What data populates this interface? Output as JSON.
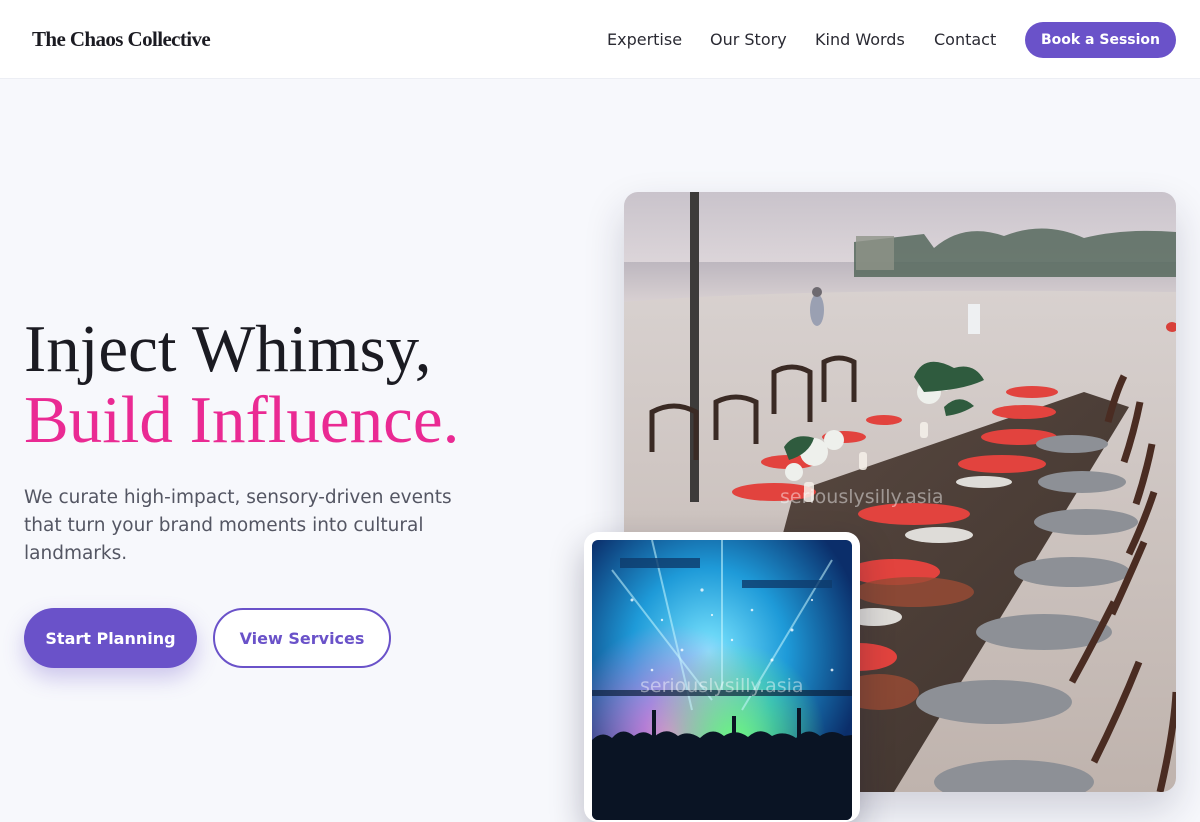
{
  "header": {
    "logo": "The Chaos Collective",
    "nav": {
      "expertise": "Expertise",
      "our_story": "Our Story",
      "kind_words": "Kind Words",
      "contact": "Contact"
    },
    "cta": "Book a Session"
  },
  "hero": {
    "headline_line1": "Inject Whimsy,",
    "headline_line2": "Build Influence.",
    "subtext": "We curate high-impact, sensory-driven events that turn your brand moments into cultural landmarks.",
    "primary_button": "Start Planning",
    "secondary_button": "View Services"
  },
  "images": {
    "main_watermark": "seriouslysilly.asia",
    "inset_watermark": "seriouslysilly.asia"
  },
  "colors": {
    "accent": "#6a52c9",
    "highlight": "#ea2a93",
    "background": "#f7f8fc"
  }
}
